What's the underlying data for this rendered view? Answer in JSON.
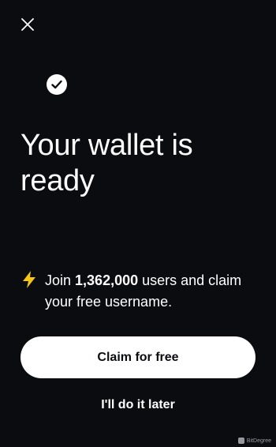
{
  "title": "Your wallet is ready",
  "promo": {
    "prefix": "Join ",
    "count": "1,362,000",
    "suffix": " users and claim your free username."
  },
  "buttons": {
    "claim_label": "Claim for free",
    "later_label": "I'll do it later"
  },
  "watermark": "BitDegree",
  "icons": {
    "close": "close-icon",
    "check": "check-circle-icon",
    "bolt": "lightning-bolt-icon"
  },
  "colors": {
    "background": "#0b0c10",
    "bolt": "#f5c518",
    "button_bg": "#ffffff"
  }
}
